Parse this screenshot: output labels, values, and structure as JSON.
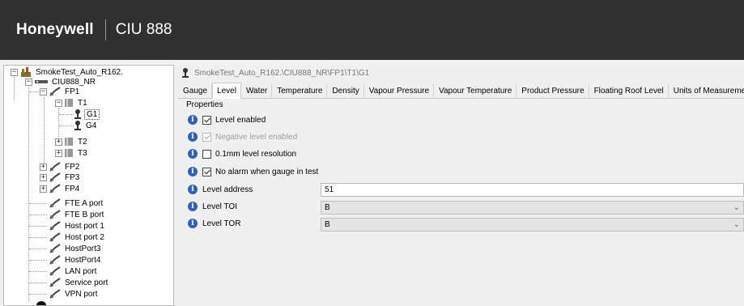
{
  "header": {
    "brand": "Honeywell",
    "product": "CIU 888"
  },
  "tree": {
    "root": "SmokeTest_Auto_R162.",
    "ciu": "CIU888_NR",
    "fp1": "FP1",
    "t1": "T1",
    "g1": "G1",
    "g4": "G4",
    "t2": "T2",
    "t3": "T3",
    "fp2": "FP2",
    "fp3": "FP3",
    "fp4": "FP4",
    "ports": [
      "FTE A port",
      "FTE B port",
      "Host port 1",
      "Host port 2",
      "HostPort3",
      "HostPort4",
      "LAN port",
      "Service port",
      "VPN port"
    ]
  },
  "path": "SmokeTest_Auto_R162.\\CIU888_NR\\FP1\\T1\\G1",
  "tabs": [
    "Gauge",
    "Level",
    "Water",
    "Temperature",
    "Density",
    "Vapour Pressure",
    "Vapour Temperature",
    "Product Pressure",
    "Floating Roof Level",
    "Units of Measurement"
  ],
  "active_tab": "Level",
  "properties": {
    "title": "Properties",
    "level_enabled": "Level enabled",
    "negative_level_enabled": "Negative level enabled",
    "resolution": "0.1mm level resolution",
    "no_alarm": "No alarm when gauge in test",
    "level_address_label": "Level address",
    "level_address_value": "51",
    "level_toi_label": "Level TOI",
    "level_toi_value": "B",
    "level_tor_label": "Level TOR",
    "level_tor_value": "B"
  },
  "colors": {
    "header_bg": "#303030",
    "info_blue": "#2f62b6"
  }
}
